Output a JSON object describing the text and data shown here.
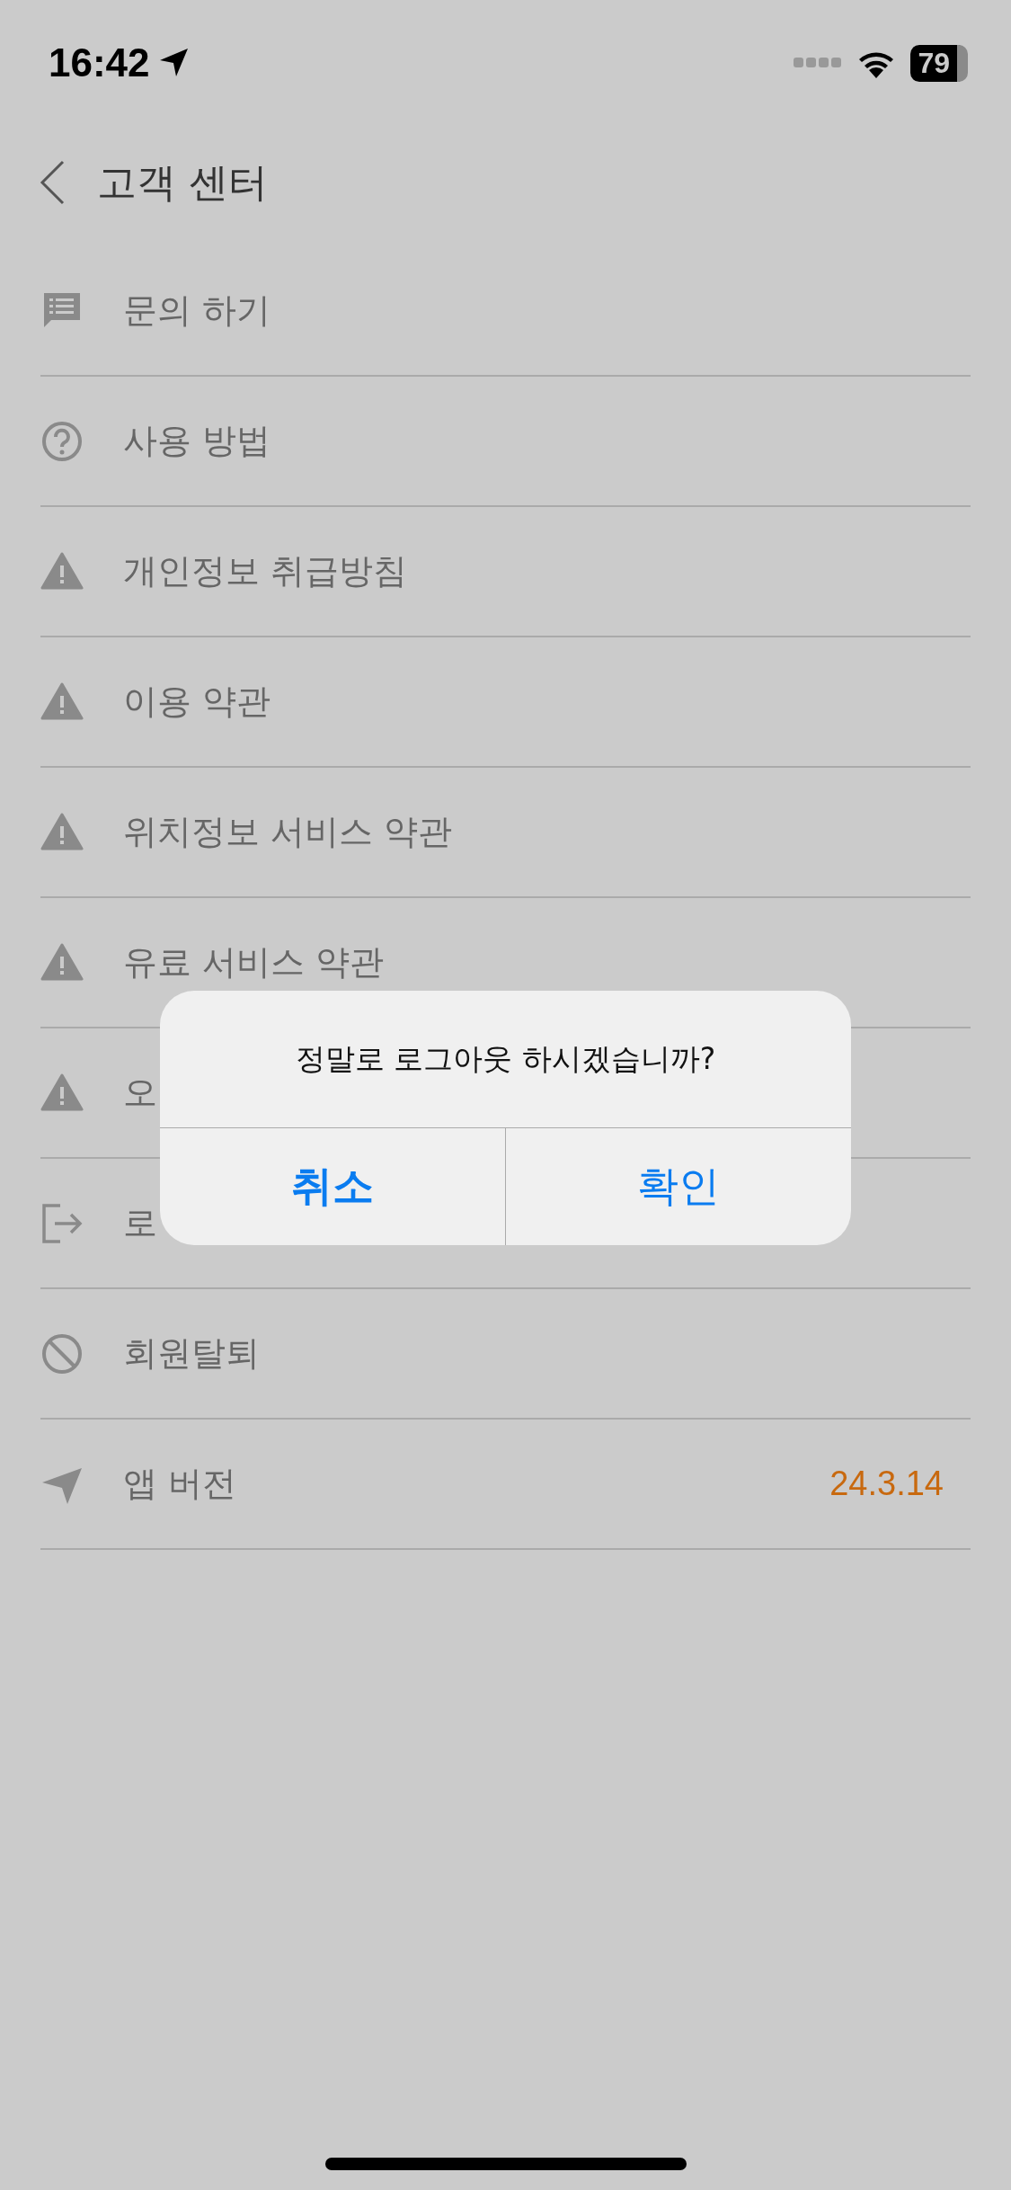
{
  "status_bar": {
    "time": "16:42",
    "battery": "79"
  },
  "header": {
    "title": "고객 센터"
  },
  "menu_items": [
    {
      "kind": "chat",
      "label": "문의 하기"
    },
    {
      "kind": "help",
      "label": "사용 방법"
    },
    {
      "kind": "warning",
      "label": "개인정보 취급방침"
    },
    {
      "kind": "warning",
      "label": "이용 약관"
    },
    {
      "kind": "warning",
      "label": "위치정보 서비스 약관"
    },
    {
      "kind": "warning",
      "label": "유료 서비스 약관"
    },
    {
      "kind": "warning",
      "label": "오"
    },
    {
      "kind": "logout",
      "label": "로"
    },
    {
      "kind": "ban",
      "label": "회원탈퇴"
    },
    {
      "kind": "send",
      "label": "앱 버전",
      "value": "24.3.14"
    }
  ],
  "dialog": {
    "message": "정말로 로그아웃 하시겠습니까?",
    "buttons": [
      {
        "label": "취소",
        "bold": true
      },
      {
        "label": "확인",
        "bold": false
      }
    ]
  }
}
